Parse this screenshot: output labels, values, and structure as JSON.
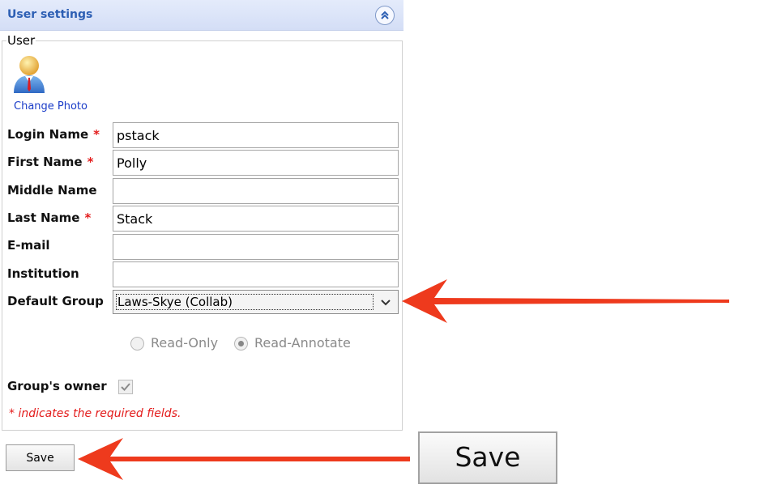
{
  "panel": {
    "title": "User settings"
  },
  "user": {
    "legend": "User",
    "change_photo": "Change Photo"
  },
  "fields": {
    "login_name": {
      "label": "Login Name",
      "required_mark": "*",
      "value": "pstack"
    },
    "first_name": {
      "label": "First Name",
      "required_mark": "*",
      "value": "Polly"
    },
    "middle_name": {
      "label": "Middle Name",
      "value": ""
    },
    "last_name": {
      "label": "Last Name",
      "required_mark": "*",
      "value": "Stack"
    },
    "email": {
      "label": "E-mail",
      "value": ""
    },
    "institution": {
      "label": "Institution",
      "value": ""
    },
    "default_group": {
      "label": "Default Group",
      "value": "Laws-Skye (Collab)"
    }
  },
  "permissions": {
    "read_only": {
      "label": "Read-Only",
      "selected": false
    },
    "read_annotate": {
      "label": "Read-Annotate",
      "selected": true
    }
  },
  "group_owner": {
    "label": "Group's owner",
    "checked": true
  },
  "required_note": "* indicates the required fields.",
  "buttons": {
    "save": "Save"
  },
  "callout": {
    "save_zoom": "Save"
  },
  "colors": {
    "header_bg": "#dce4f8",
    "header_text": "#2d5fb4",
    "required": "#e31b1b",
    "link": "#1a3cc8",
    "annotation_arrow": "#ee3a1d"
  },
  "icons": {
    "collapse": "double-chevron-up-icon",
    "avatar": "user-avatar-icon",
    "dropdown": "chevron-down-icon",
    "checkmark": "checkmark-icon"
  }
}
